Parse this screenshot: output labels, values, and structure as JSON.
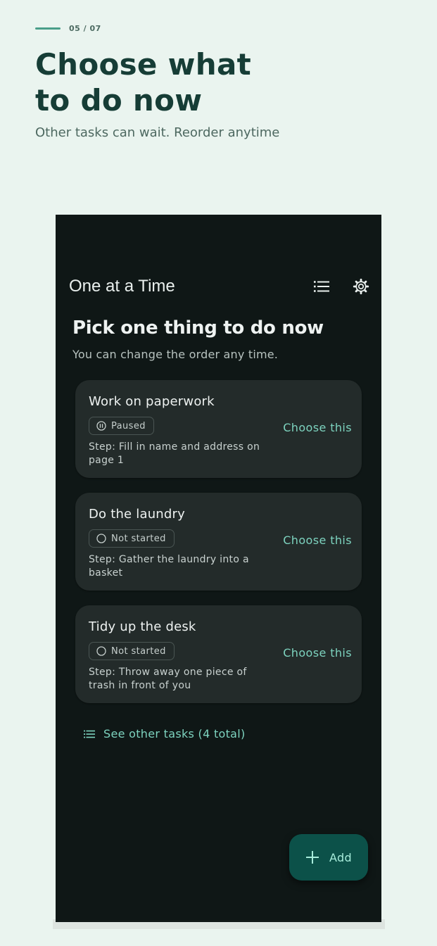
{
  "promo": {
    "step": "05 / 07",
    "title_line1": "Choose what",
    "title_line2": "to do now",
    "subtitle": "Other tasks can wait. Reorder anytime"
  },
  "app": {
    "title": "One at a Time",
    "icons": {
      "list": "list-icon",
      "settings": "gear-icon"
    }
  },
  "main": {
    "heading": "Pick one thing to do now",
    "subheading": "You can change the order any time.",
    "tasks": [
      {
        "name": "Work on paperwork",
        "status": "Paused",
        "status_icon": "pause-icon",
        "step": "Step: Fill in name and address on page 1",
        "action": "Choose this"
      },
      {
        "name": "Do the laundry",
        "status": "Not started",
        "status_icon": "circle-icon",
        "step": "Step: Gather the laundry into a basket",
        "action": "Choose this"
      },
      {
        "name": "Tidy up the desk",
        "status": "Not started",
        "status_icon": "circle-icon",
        "step": "Step: Throw away one piece of trash in front of you",
        "action": "Choose this"
      }
    ],
    "see_others": "See other tasks (4 total)"
  },
  "fab": {
    "label": "Add",
    "icon": "plus-icon"
  },
  "colors": {
    "background": "#eaf4ef",
    "promo_title": "#163d36",
    "phone_bg": "#0f1716",
    "card_bg": "#232b2a",
    "accent": "#7dd3bf",
    "fab_bg": "#0c5149"
  }
}
